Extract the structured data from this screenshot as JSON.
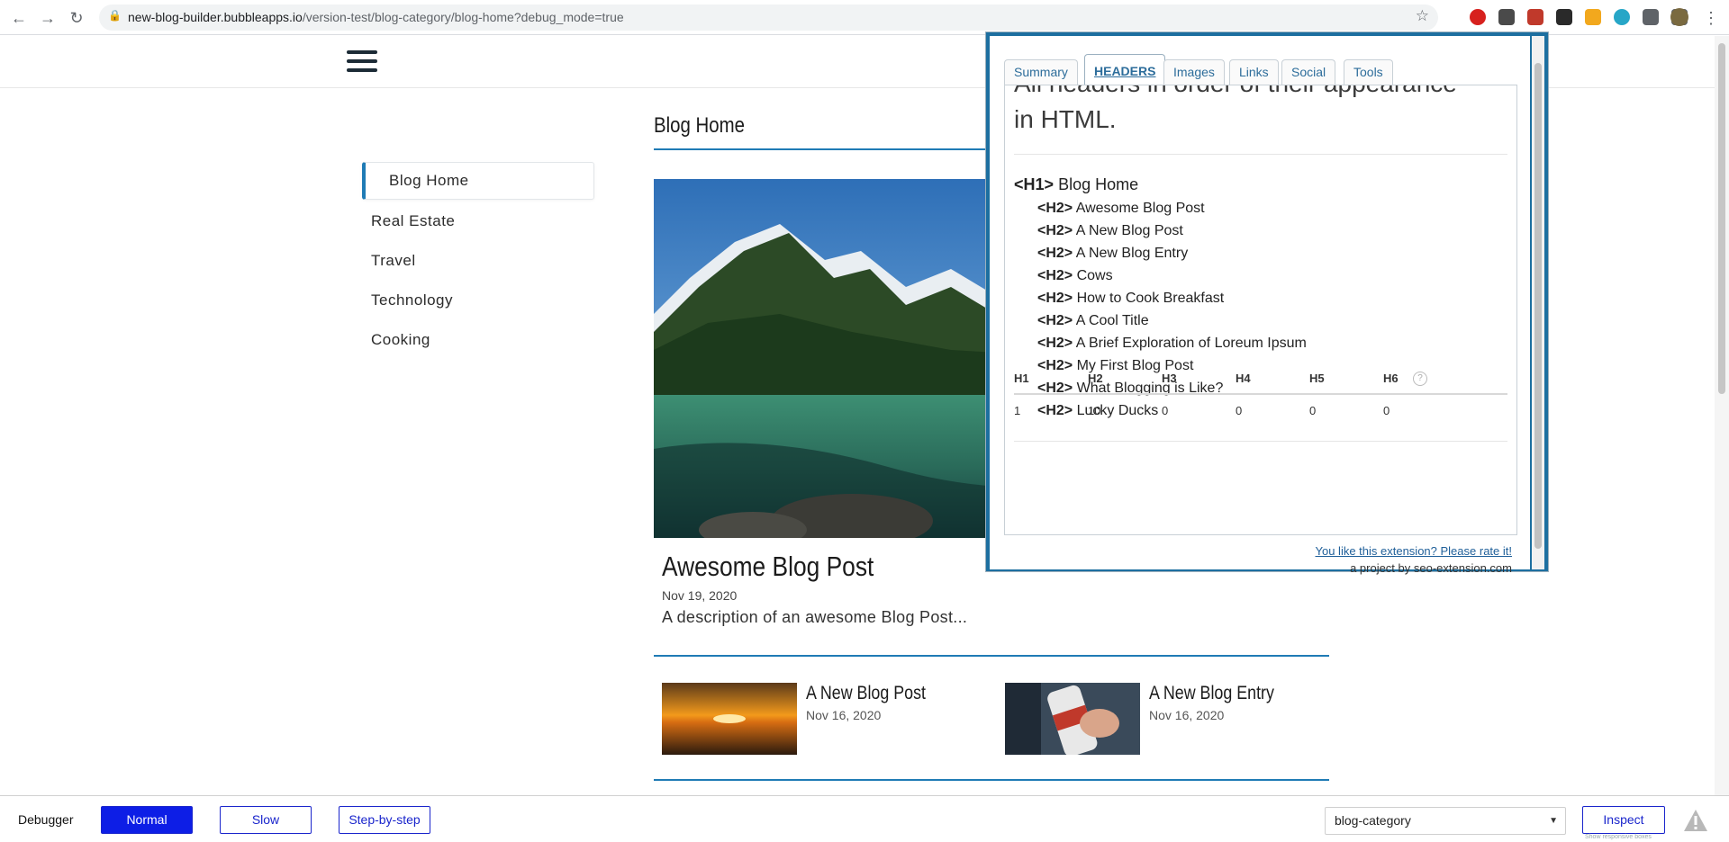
{
  "browser": {
    "url_host": "new-blog-builder.bubbleapps.io",
    "url_path": "/version-test/blog-category/blog-home?debug_mode=true",
    "icons": [
      "back-icon",
      "forward-icon",
      "reload-icon",
      "lock-icon",
      "star-icon",
      "extensions-icon",
      "menu-dots-icon"
    ]
  },
  "sidebar": {
    "items": [
      {
        "label": "Blog Home",
        "active": true
      },
      {
        "label": "Real Estate"
      },
      {
        "label": "Travel"
      },
      {
        "label": "Technology"
      },
      {
        "label": "Cooking"
      }
    ]
  },
  "main": {
    "title": "Blog Home",
    "featured": {
      "title": "Awesome Blog Post",
      "date": "Nov 19, 2020",
      "description": "A description of an awesome Blog Post..."
    },
    "cards": [
      {
        "title": "A New Blog Post",
        "date": "Nov 16, 2020"
      },
      {
        "title": "A New Blog Entry",
        "date": "Nov 16, 2020"
      }
    ]
  },
  "seo_extension": {
    "tabs": [
      "Summary",
      "HEADERS",
      "Images",
      "Links",
      "Social",
      "Tools"
    ],
    "active_tab": "HEADERS",
    "intro": "All headers in order of their appearance in HTML.",
    "h1": {
      "tag": "<H1>",
      "text": "Blog Home"
    },
    "h2": [
      {
        "tag": "<H2>",
        "text": "Awesome Blog Post"
      },
      {
        "tag": "<H2>",
        "text": "A New Blog Post"
      },
      {
        "tag": "<H2>",
        "text": "A New Blog Entry"
      },
      {
        "tag": "<H2>",
        "text": "Cows"
      },
      {
        "tag": "<H2>",
        "text": "How to Cook Breakfast"
      },
      {
        "tag": "<H2>",
        "text": "A Cool Title"
      },
      {
        "tag": "<H2>",
        "text": "A Brief Exploration of Loreum Ipsum"
      },
      {
        "tag": "<H2>",
        "text": "My First Blog Post"
      },
      {
        "tag": "<H2>",
        "text": "What Blogging is Like?"
      },
      {
        "tag": "<H2>",
        "text": "Lucky Ducks"
      }
    ],
    "table": {
      "headers": [
        "H1",
        "H2",
        "H3",
        "H4",
        "H5",
        "H6"
      ],
      "values": [
        "1",
        "10",
        "0",
        "0",
        "0",
        "0"
      ]
    },
    "rate_link": "You like this extension? Please rate it!",
    "footer": "a project by seo-extension.com"
  },
  "debugger": {
    "label": "Debugger",
    "modes": [
      "Normal",
      "Slow",
      "Step-by-step"
    ],
    "active_mode": "Normal",
    "page_select": "blog-category",
    "inspect_label": "Inspect",
    "hint": "Show responsive boxes"
  },
  "colors": {
    "accent": "#1f7bb5",
    "debugger_active": "#0d1ee6",
    "seo_frame": "#1d6fa0"
  }
}
